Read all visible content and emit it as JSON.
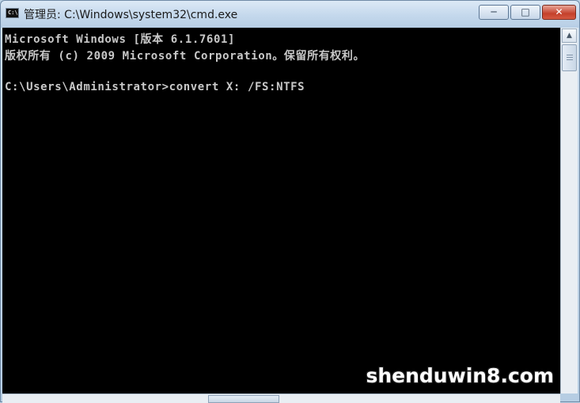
{
  "window": {
    "title": "管理员: C:\\Windows\\system32\\cmd.exe",
    "app_icon": "C:\\",
    "buttons": {
      "minimize": "─",
      "maximize": "□",
      "close": "✕"
    }
  },
  "console": {
    "lines": [
      "Microsoft Windows [版本 6.1.7601]",
      "版权所有 (c) 2009 Microsoft Corporation。保留所有权利。",
      "C:\\Users\\Administrator>convert X: /FS:NTFS"
    ]
  },
  "scrollbar": {
    "up_arrow": "▲"
  },
  "watermark": "shenduwin8.com"
}
